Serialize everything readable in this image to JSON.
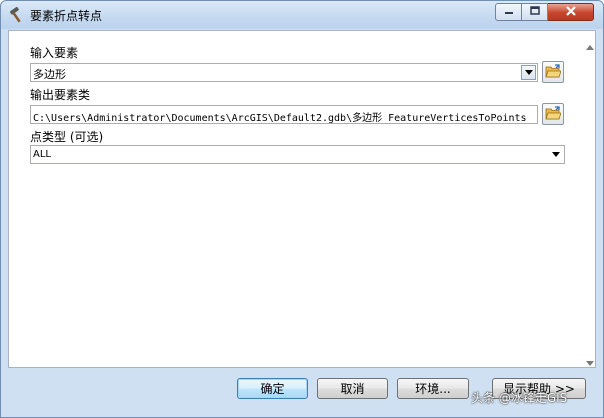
{
  "window": {
    "title": "要素折点转点"
  },
  "form": {
    "input_label": "输入要素",
    "input_value": "多边形",
    "output_label": "输出要素类",
    "output_value": "C:\\Users\\Administrator\\Documents\\ArcGIS\\Default2.gdb\\多边形_FeatureVerticesToPoints",
    "point_type_label": "点类型 (可选)",
    "point_type_value": "ALL"
  },
  "buttons": {
    "ok": "确定",
    "cancel": "取消",
    "environments": "环境...",
    "show_help": "显示帮助 >>"
  },
  "watermark": "头条 @冰锋走GIS",
  "icons": {
    "title": "hammer-icon",
    "browse": "open-folder-icon",
    "dropdown": "chevron-down-icon"
  }
}
